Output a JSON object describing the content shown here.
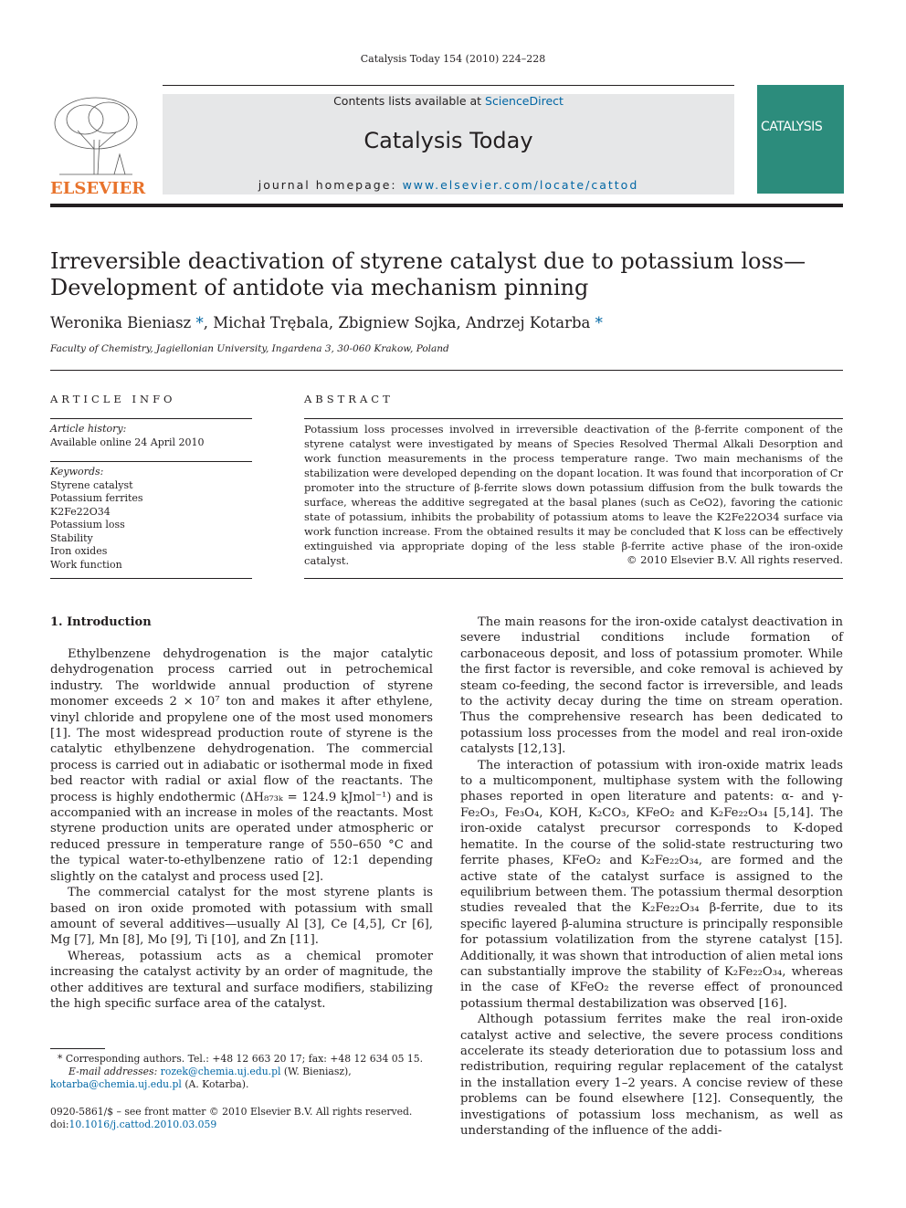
{
  "running_header": "Catalysis Today 154 (2010) 224–228",
  "masthead": {
    "contents_prefix": "Contents lists available at ",
    "contents_link": "ScienceDirect",
    "journal_title": "Catalysis Today",
    "homepage_prefix": "journal homepage: ",
    "homepage_link": "www.elsevier.com/locate/cattod",
    "publisher_logo": "ELSEVIER",
    "cover_title": "CATALYSIS",
    "accent_color": "#0066a4",
    "publisher_color": "#e8732c"
  },
  "article": {
    "title": "Irreversible deactivation of styrene catalyst due to potassium loss—Development of antidote via mechanism pinning",
    "authors": [
      {
        "name": "Weronika Bieniasz",
        "corresponding": true
      },
      {
        "name": "Michał Trębala",
        "corresponding": false
      },
      {
        "name": "Zbigniew Sojka",
        "corresponding": false
      },
      {
        "name": "Andrzej Kotarba",
        "corresponding": true
      }
    ],
    "affiliation": "Faculty of Chemistry, Jagiellonian University, Ingardena 3, 30-060 Krakow, Poland"
  },
  "article_info": {
    "heading": "ARTICLE INFO",
    "history_label": "Article history:",
    "history_value": "Available online 24 April 2010",
    "keywords_label": "Keywords:",
    "keywords": [
      "Styrene catalyst",
      "Potassium ferrites",
      "K2Fe22O34",
      "Potassium loss",
      "Stability",
      "Iron oxides",
      "Work function"
    ]
  },
  "abstract": {
    "heading": "ABSTRACT",
    "text": "Potassium loss processes involved in irreversible deactivation of the β-ferrite component of the styrene catalyst were investigated by means of Species Resolved Thermal Alkali Desorption and work function measurements in the process temperature range. Two main mechanisms of the stabilization were developed depending on the dopant location. It was found that incorporation of Cr promoter into the structure of β-ferrite slows down potassium diffusion from the bulk towards the surface, whereas the additive segregated at the basal planes (such as CeO2), favoring the cationic state of potassium, inhibits the probability of potassium atoms to leave the K2Fe22O34 surface via work function increase. From the obtained results it may be concluded that K loss can be effectively extinguished via appropriate doping of the less stable β-ferrite active phase of the iron-oxide catalyst.",
    "copyright": "© 2010 Elsevier B.V. All rights reserved."
  },
  "body": {
    "section_heading": "1.  Introduction",
    "left_paragraphs": [
      "Ethylbenzene dehydrogenation is the major catalytic dehydrogenation process carried out in petrochemical industry. The worldwide annual production of styrene monomer exceeds 2 × 10⁷ ton and makes it after ethylene, vinyl chloride and propylene one of the most used monomers [1]. The most widespread production route of styrene is the catalytic ethylbenzene dehydrogenation. The commercial process is carried out in adiabatic or isothermal mode in fixed bed reactor with radial or axial flow of the reactants. The process is highly endothermic (ΔH₈₇₃ₖ = 124.9 kJmol⁻¹) and is accompanied with an increase in moles of the reactants. Most styrene production units are operated under atmospheric or reduced pressure in temperature range of 550–650 °C and the typical water-to-ethylbenzene ratio of 12:1 depending slightly on the catalyst and process used [2].",
      "The commercial catalyst for the most styrene plants is based on iron oxide promoted with potassium with small amount of several additives—usually Al [3], Ce [4,5], Cr [6], Mg [7], Mn [8], Mo [9], Ti [10], and Zn [11].",
      "Whereas, potassium acts as a chemical promoter increasing the catalyst activity by an order of magnitude, the other additives are textural and surface modifiers, stabilizing the high specific surface area of the catalyst."
    ],
    "right_paragraphs": [
      "The main reasons for the iron-oxide catalyst deactivation in severe industrial conditions include formation of carbonaceous deposit, and loss of potassium promoter. While the first factor is reversible, and coke removal is achieved by steam co-feeding, the second factor is irreversible, and leads to the activity decay during the time on stream operation. Thus the comprehensive research has been dedicated to potassium loss processes from the model and real iron-oxide catalysts [12,13].",
      "The interaction of potassium with iron-oxide matrix leads to a multicomponent, multiphase system with the following phases reported in open literature and patents: α- and γ-Fe₂O₃, Fe₃O₄, KOH, K₂CO₃, KFeO₂ and K₂Fe₂₂O₃₄ [5,14]. The iron-oxide catalyst precursor corresponds to K-doped hematite. In the course of the solid-state restructuring two ferrite phases, KFeO₂ and K₂Fe₂₂O₃₄, are formed and the active state of the catalyst surface is assigned to the equilibrium between them. The potassium thermal desorption studies revealed that the K₂Fe₂₂O₃₄ β-ferrite, due to its specific layered β-alumina structure is principally responsible for potassium volatilization from the styrene catalyst [15]. Additionally, it was shown that introduction of alien metal ions can substantially improve the stability of K₂Fe₂₂O₃₄, whereas in the case of KFeO₂ the reverse effect of pronounced potassium thermal destabilization was observed [16].",
      "Although potassium ferrites make the real iron-oxide catalyst active and selective, the severe process conditions accelerate its steady deterioration due to potassium loss and redistribution, requiring regular replacement of the catalyst in the installation every 1–2 years. A concise review of these problems can be found elsewhere [12]. Consequently, the investigations of potassium loss mechanism, as well as understanding of the influence of the addi-"
    ]
  },
  "footnotes": {
    "corresponding": "* Corresponding authors. Tel.: +48 12 663 20 17; fax: +48 12 634 05 15.",
    "email_label": "E-mail addresses:",
    "email1": "rozek@chemia.uj.edu.pl",
    "email1_owner": "(W. Bieniasz),",
    "email2": "kotarba@chemia.uj.edu.pl",
    "email2_owner": "(A. Kotarba).",
    "issn": "0920-5861/$ – see front matter © 2010 Elsevier B.V. All rights reserved.",
    "doi_label": "doi:",
    "doi": "10.1016/j.cattod.2010.03.059"
  }
}
